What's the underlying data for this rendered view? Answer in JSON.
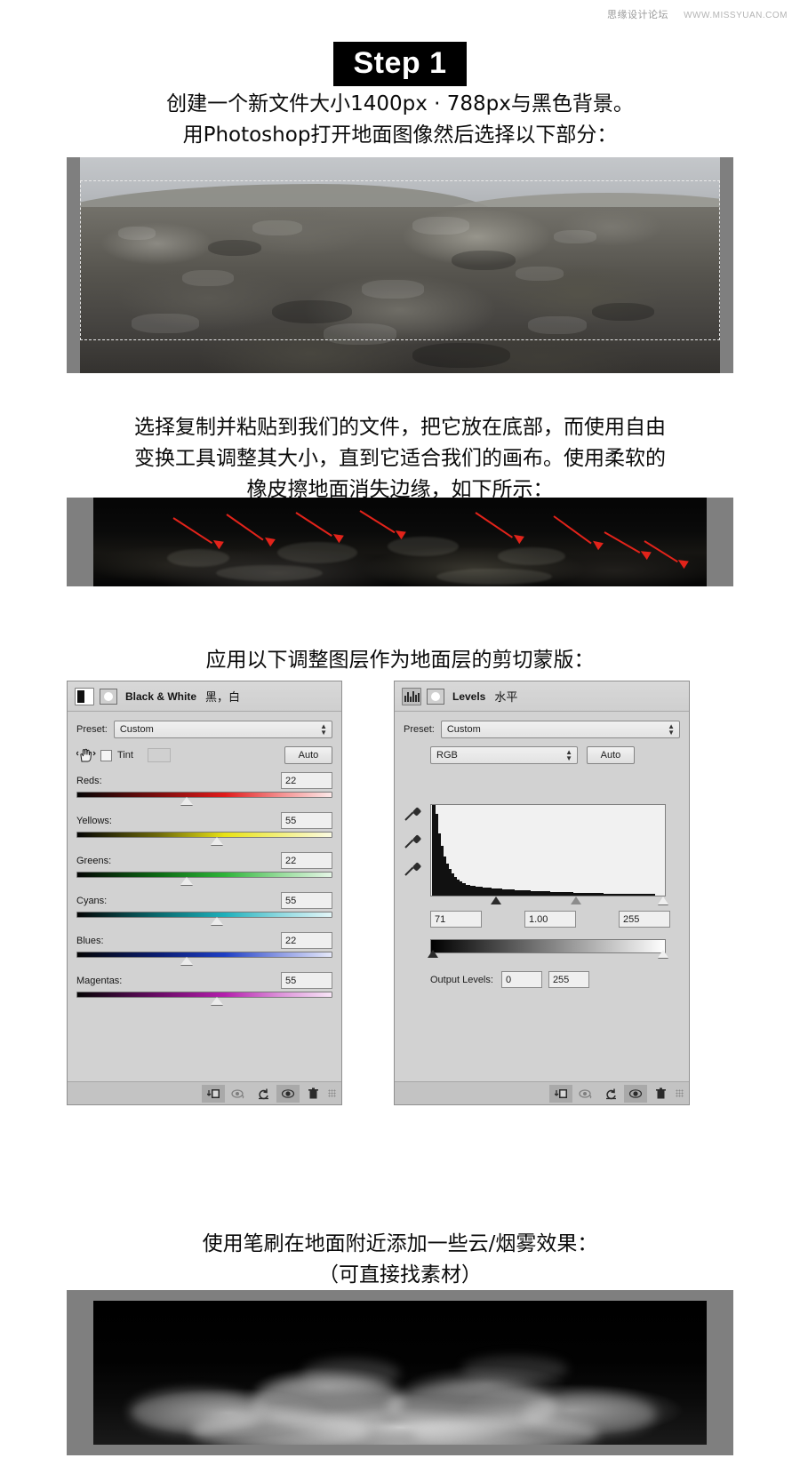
{
  "watermark": {
    "site": "思缘设计论坛",
    "url": "WWW.MISSYUAN.COM"
  },
  "step": {
    "badge": "Step 1"
  },
  "paragraphs": {
    "intro": [
      "创建一个新文件大小1400px · 788px与黑色背景。",
      "用Photoshop打开地面图像然后选择以下部分："
    ],
    "paste": [
      "选择复制并粘贴到我们的文件，把它放在底部，而使用自由",
      "变换工具调整其大小，直到它适合我们的画布。使用柔软的",
      "橡皮擦地面消失边缘，如下所示："
    ],
    "adjust": [
      "应用以下调整图层作为地面层的剪切蒙版："
    ],
    "clouds": [
      "使用笔刷在地面附近添加一些云/烟雾效果：",
      "（可直接找素材）"
    ]
  },
  "bw_panel": {
    "title_en": "Black & White",
    "title_cn": "黑，白",
    "preset_label": "Preset:",
    "preset_value": "Custom",
    "tint_label": "Tint",
    "auto_label": "Auto",
    "sliders": [
      {
        "label": "Reds:",
        "value": "22",
        "pos": 43
      },
      {
        "label": "Yellows:",
        "value": "55",
        "pos": 55
      },
      {
        "label": "Greens:",
        "value": "22",
        "pos": 43
      },
      {
        "label": "Cyans:",
        "value": "55",
        "pos": 55
      },
      {
        "label": "Blues:",
        "value": "22",
        "pos": 43
      },
      {
        "label": "Magentas:",
        "value": "55",
        "pos": 55
      }
    ]
  },
  "levels_panel": {
    "title_en": "Levels",
    "title_cn": "水平",
    "preset_label": "Preset:",
    "preset_value": "Custom",
    "channel_value": "RGB",
    "auto_label": "Auto",
    "input_black": "71",
    "input_gamma": "1.00",
    "input_white": "255",
    "output_label": "Output Levels:",
    "output_black": "0",
    "output_white": "255"
  },
  "footer_icons": {
    "clip_to_layer": "clip-to-layer-icon",
    "view_previous": "view-previous-state-icon",
    "reset": "reset-icon",
    "toggle_visibility": "toggle-visibility-icon",
    "delete": "delete-layer-icon"
  },
  "colors": {
    "panel_bg": "#d2d2d2",
    "arrow_red": "#e2231a",
    "frame_gray": "#7f7f7f",
    "badge_black": "#000000"
  }
}
